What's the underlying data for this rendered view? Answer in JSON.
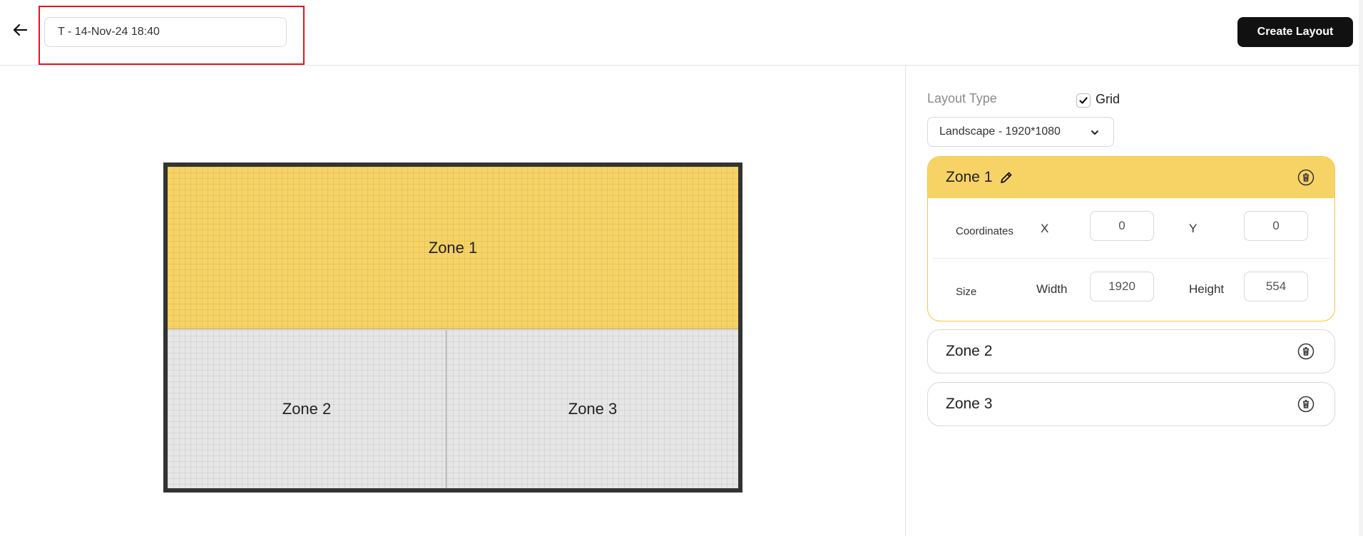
{
  "header": {
    "title_value": "T - 14-Nov-24 18:40",
    "create_button_label": "Create Layout"
  },
  "canvas": {
    "zones": [
      {
        "label": "Zone 1",
        "color": "#f7d366",
        "selected": true
      },
      {
        "label": "Zone 2",
        "color": "#e6e6e6",
        "selected": false
      },
      {
        "label": "Zone 3",
        "color": "#e6e6e6",
        "selected": false
      }
    ]
  },
  "panel": {
    "layout_type_label": "Layout Type",
    "grid_label": "Grid",
    "grid_checked": true,
    "layout_select_value": "Landscape - 1920*1080",
    "zones": [
      {
        "name": "Zone 1",
        "expanded": true,
        "coordinates_label": "Coordinates",
        "x_label": "X",
        "x_value": "0",
        "y_label": "Y",
        "y_value": "0",
        "size_label": "Size",
        "width_label": "Width",
        "width_value": "1920",
        "height_label": "Height",
        "height_value": "554"
      },
      {
        "name": "Zone 2",
        "expanded": false
      },
      {
        "name": "Zone 3",
        "expanded": false
      }
    ]
  },
  "colors": {
    "accent": "#f7d366",
    "accent_border": "#f2c649",
    "primary_button": "#111111",
    "highlight_box": "#e8141c"
  },
  "icons": {
    "back": "arrow-left-icon",
    "edit": "pencil-icon",
    "delete": "trash-icon",
    "dropdown": "chevron-down-icon",
    "check": "check-icon"
  }
}
